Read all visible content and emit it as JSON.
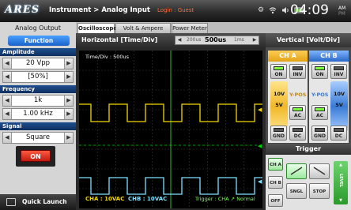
{
  "app": {
    "logo": "ARES",
    "breadcrumb": "Instrument > Analog Input",
    "login_status": "Login : Guest",
    "clock": {
      "time": "04:09",
      "ampm_top": "AM",
      "ampm_bottom": "PM"
    },
    "status_icons": [
      "settings-icon",
      "wifi-icon",
      "volume-icon",
      "battery-icon"
    ]
  },
  "left_panel": {
    "title": "Analog Output",
    "function_label": "Function",
    "amplitude": {
      "label": "Amplitude",
      "value": "20 Vpp",
      "percent": "[50%]"
    },
    "frequency": {
      "label": "Frequency",
      "value": "1k",
      "display": "1.00 kHz"
    },
    "signal": {
      "label": "Signal",
      "value": "Square"
    },
    "on_button": "ON",
    "quick_launch": "Quick Launch"
  },
  "tabs": [
    "Oscilloscope",
    "Volt & Ampere Meter",
    "Power Meter"
  ],
  "horizontal": {
    "title": "Horizontal [Time/Div]",
    "options": [
      "200us",
      "500us",
      "1ms"
    ],
    "selected": "500us"
  },
  "screen": {
    "time_div": "Time/Div : 500us",
    "cha_readout": "CHA : 10VAC",
    "chb_readout": "CHB : 10VAC",
    "trigger_readout": "Trigger : CHA ↗ Normal",
    "colors": {
      "cha": "#f2d600",
      "chb": "#7fe0ff",
      "grid": "#3a3a3a",
      "axis": "#2fb82f",
      "trigger_level": "#00d000"
    }
  },
  "vertical": {
    "title": "Vertical [Volt/Div]",
    "cha": {
      "label": "CH A",
      "on": "ON",
      "inv": "INV",
      "ypos": "Y-POS",
      "volt_high": "10V",
      "volt_low": "5V",
      "ac": "AC",
      "gnd": "GND",
      "dc": "DC",
      "color": "#f2d600"
    },
    "chb": {
      "label": "CH B",
      "on": "ON",
      "inv": "INV",
      "ypos": "Y-POS",
      "volt_high": "10V",
      "volt_low": "5V",
      "ac": "AC",
      "gnd": "GND",
      "dc": "DC",
      "color": "#7fe0ff"
    }
  },
  "trigger": {
    "title": "Trigger",
    "cha": "CH A",
    "chb": "CH B",
    "off": "OFF",
    "single": "SNGL",
    "stop": "STOP",
    "level": "LEVEL"
  }
}
